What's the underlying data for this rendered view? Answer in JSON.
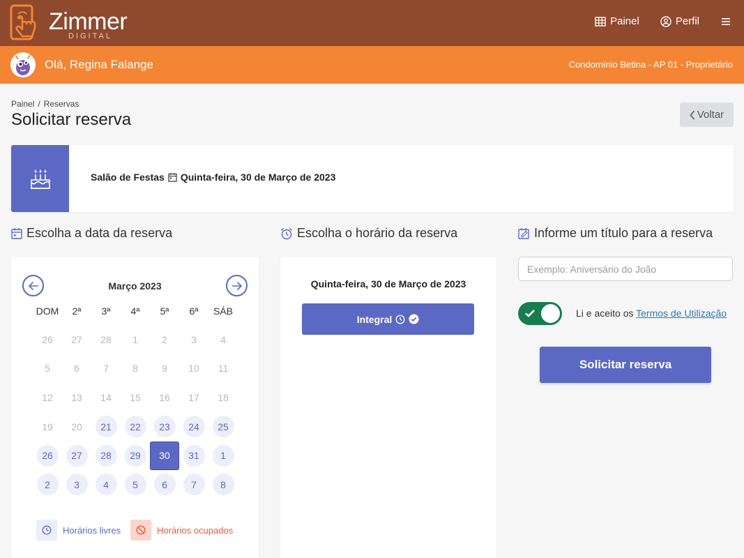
{
  "brand": {
    "name": "Zimmer",
    "sub": "DIGITAL"
  },
  "topnav": {
    "panel": "Painel",
    "profile": "Perfil"
  },
  "user": {
    "greeting": "Olá, Regina Falange",
    "condo": "Condomínio Betina - AP 01 - Proprietário"
  },
  "breadcrumb": {
    "root": "Painel",
    "sep": "/",
    "current": "Reservas"
  },
  "page": {
    "title": "Solicitar reserva",
    "back_label": "Voltar"
  },
  "summary": {
    "area": "Salão de Festas",
    "date": "Quinta-feira, 30 de Março de 2023"
  },
  "sections": {
    "date": "Escolha a data da reserva",
    "time": "Escolha o horário da reserva",
    "title": "Informe um título para a reserva"
  },
  "calendar": {
    "month": "Março 2023",
    "weekdays": [
      "DOM",
      "2ª",
      "3ª",
      "4ª",
      "5ª",
      "6ª",
      "SÁB"
    ],
    "days": [
      {
        "n": "26",
        "s": "past"
      },
      {
        "n": "27",
        "s": "past"
      },
      {
        "n": "28",
        "s": "past"
      },
      {
        "n": "1",
        "s": "past"
      },
      {
        "n": "2",
        "s": "past"
      },
      {
        "n": "3",
        "s": "past"
      },
      {
        "n": "4",
        "s": "past"
      },
      {
        "n": "5",
        "s": "past"
      },
      {
        "n": "6",
        "s": "past"
      },
      {
        "n": "7",
        "s": "past"
      },
      {
        "n": "8",
        "s": "past"
      },
      {
        "n": "9",
        "s": "past"
      },
      {
        "n": "10",
        "s": "past"
      },
      {
        "n": "11",
        "s": "past"
      },
      {
        "n": "12",
        "s": "past"
      },
      {
        "n": "13",
        "s": "past"
      },
      {
        "n": "14",
        "s": "past"
      },
      {
        "n": "15",
        "s": "past"
      },
      {
        "n": "16",
        "s": "past"
      },
      {
        "n": "17",
        "s": "past"
      },
      {
        "n": "18",
        "s": "past"
      },
      {
        "n": "19",
        "s": "past"
      },
      {
        "n": "20",
        "s": "past"
      },
      {
        "n": "21",
        "s": "free"
      },
      {
        "n": "22",
        "s": "free"
      },
      {
        "n": "23",
        "s": "free"
      },
      {
        "n": "24",
        "s": "free"
      },
      {
        "n": "25",
        "s": "free"
      },
      {
        "n": "26",
        "s": "free"
      },
      {
        "n": "27",
        "s": "free"
      },
      {
        "n": "28",
        "s": "free"
      },
      {
        "n": "29",
        "s": "free"
      },
      {
        "n": "30",
        "s": "sel"
      },
      {
        "n": "31",
        "s": "free"
      },
      {
        "n": "1",
        "s": "free"
      },
      {
        "n": "2",
        "s": "free"
      },
      {
        "n": "3",
        "s": "free"
      },
      {
        "n": "4",
        "s": "free"
      },
      {
        "n": "5",
        "s": "free"
      },
      {
        "n": "6",
        "s": "free"
      },
      {
        "n": "7",
        "s": "free"
      },
      {
        "n": "8",
        "s": "free"
      }
    ],
    "legend_free": "Horários livres",
    "legend_busy": "Horários ocupados"
  },
  "time": {
    "date": "Quinta-feira, 30 de Março de 2023",
    "slot_label": "Integral"
  },
  "form": {
    "title_placeholder": "Exemplo: Aniversário do João",
    "terms_text": "Li e aceito os",
    "terms_link": "Termos de Utilização",
    "submit": "Solicitar reserva"
  },
  "colors": {
    "topbar": "#8f4a2e",
    "accent_bar": "#f48534",
    "primary": "#5c69c4",
    "toggle_on": "#177d4f",
    "busy": "#e85a3b"
  },
  "icons": [
    "phone-touch-logo-icon",
    "grid-icon",
    "user-circle-icon",
    "menu-icon",
    "cake-icon",
    "calendar-icon",
    "alarm-clock-icon",
    "edit-calendar-icon",
    "arrow-left-icon",
    "arrow-right-icon",
    "clock-icon",
    "check-circle-icon",
    "ban-icon",
    "check-icon",
    "chevron-left-icon"
  ]
}
